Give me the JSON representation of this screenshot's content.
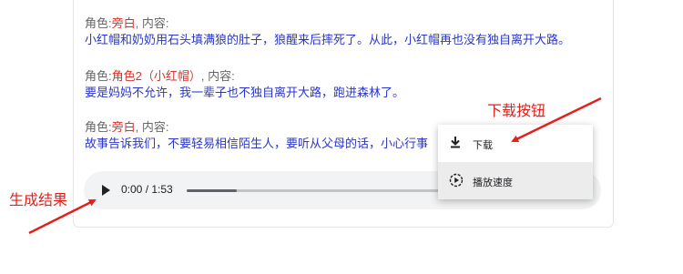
{
  "dialogue": [
    {
      "role_prefix": "角色:",
      "role": "旁白",
      "content_prefix": ", 内容:",
      "content": "小红帽和奶奶用石头填满狼的肚子，狼醒来后摔死了。从此，小红帽再也没有独自离开大路。"
    },
    {
      "role_prefix": "角色:",
      "role": "角色2（小红帽）",
      "content_prefix": ", 内容:",
      "content": "要是妈妈不允许，我一辈子也不独自离开大路，跑进森林了。"
    },
    {
      "role_prefix": "角色:",
      "role": "旁白",
      "content_prefix": ", 内容:",
      "content": "故事告诉我们，不要轻易相信陌生人，要听从父母的话，小心行事"
    }
  ],
  "player": {
    "time": "0:00 / 1:53",
    "progress_fraction": 0.19,
    "play_icon": "play-icon"
  },
  "menu": {
    "download_label": "下载",
    "download_icon": "download-icon",
    "speed_label": "播放速度",
    "speed_icon": "playback-speed-icon"
  },
  "annotations": {
    "download_button": "下载按钮",
    "result": "生成结果"
  },
  "colors": {
    "role": "#d9342b",
    "content": "#2a36c8",
    "annotation": "#e2211c",
    "player_bg": "#f1f3f4"
  }
}
